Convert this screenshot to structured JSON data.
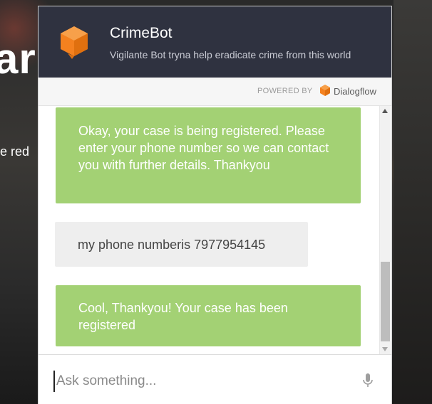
{
  "background": {
    "big_text": "arc",
    "small_text": "e red"
  },
  "widget": {
    "title": "CrimeBot",
    "subtitle": "Vigilante Bot tryna help eradicate crime from this world",
    "powered_by_label": "POWERED BY",
    "powered_by_brand": "Dialogflow",
    "logo_icon": "cube-icon",
    "brand_color": "#f4811f",
    "header_color": "#2f3240",
    "bot_bubble_color": "#a3d174",
    "user_bubble_color": "#eeeeee"
  },
  "messages": [
    {
      "sender": "bot",
      "text": "Okay, your case is being registered. Please enter your phone number so we can contact you with further details. Thankyou"
    },
    {
      "sender": "user",
      "text": "my phone numberis 7977954145"
    },
    {
      "sender": "bot",
      "text": "Cool, Thankyou! Your case has been registered"
    }
  ],
  "input": {
    "placeholder": "Ask something...",
    "value": ""
  },
  "icons": {
    "mic": "microphone-icon"
  }
}
